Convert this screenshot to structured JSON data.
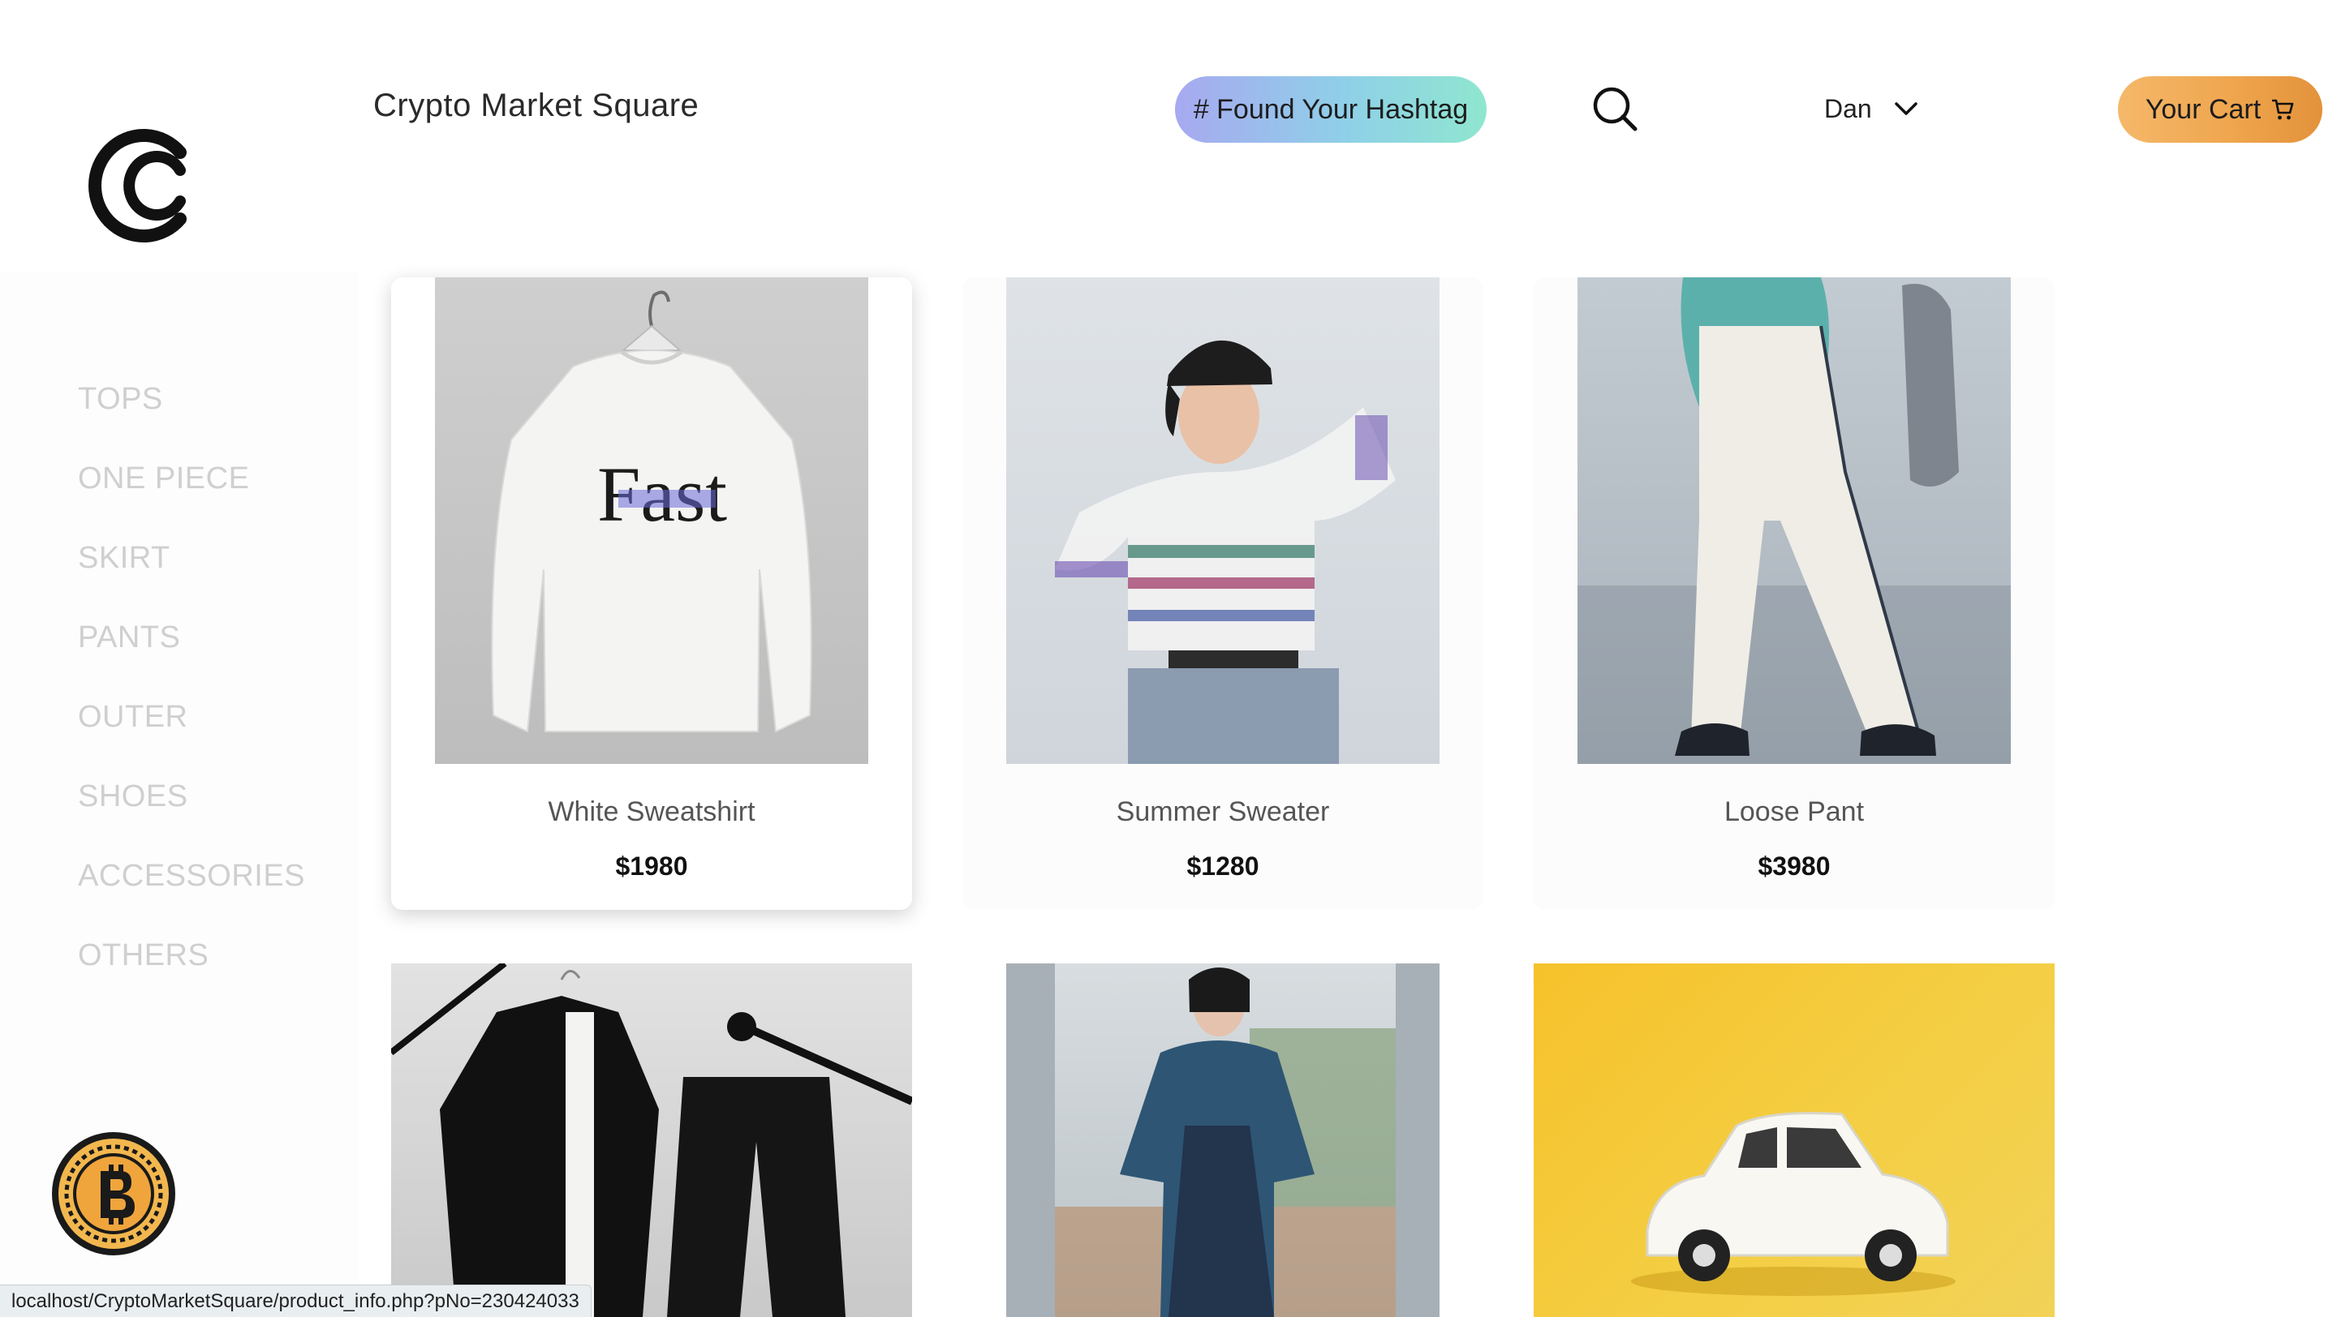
{
  "header": {
    "brand_title": "Crypto Market Square",
    "hashtag_button": "# Found Your Hashtag",
    "search_icon": "search-icon",
    "user_name": "Dan",
    "cart_button": "Your Cart"
  },
  "sidebar": {
    "categories": [
      "TOPS",
      "ONE PIECE",
      "SKIRT",
      "PANTS",
      "OUTER",
      "SHOES",
      "ACCESSORIES",
      "OTHERS"
    ]
  },
  "products": [
    {
      "name": "White Sweatshirt",
      "price": "$1980",
      "graphic_text": "Fast"
    },
    {
      "name": "Summer Sweater",
      "price": "$1280"
    },
    {
      "name": "Loose Pant",
      "price": "$3980"
    }
  ],
  "statusbar": {
    "url": "localhost/CryptoMarketSquare/product_info.php?pNo=230424033"
  },
  "colors": {
    "hashtag_gradient": [
      "#a7a9f0",
      "#8fe6cf"
    ],
    "cart_gradient": [
      "#f5b86a",
      "#e3923a"
    ],
    "category_text": "#cfcfcf"
  }
}
